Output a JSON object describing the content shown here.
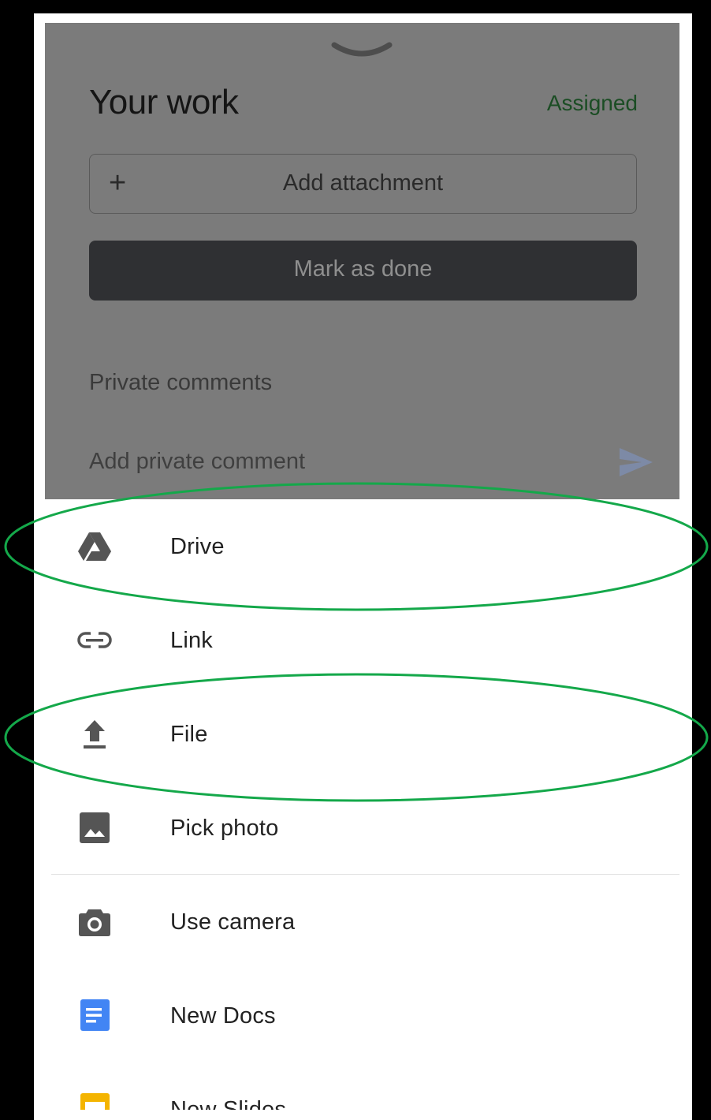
{
  "card": {
    "title": "Your work",
    "status": "Assigned",
    "add_attachment_label": "Add attachment",
    "add_icon_glyph": "+",
    "mark_done_label": "Mark as done",
    "private_comments_heading": "Private comments",
    "comment_placeholder": "Add private comment"
  },
  "sheet": {
    "items": [
      {
        "label": "Drive",
        "icon": "drive-icon"
      },
      {
        "label": "Link",
        "icon": "link-icon"
      },
      {
        "label": "File",
        "icon": "upload-icon"
      },
      {
        "label": "Pick photo",
        "icon": "image-icon"
      },
      {
        "label": "Use camera",
        "icon": "camera-icon"
      },
      {
        "label": "New Docs",
        "icon": "docs-icon"
      },
      {
        "label": "New Slides",
        "icon": "slides-icon"
      }
    ]
  },
  "colors": {
    "status_green": "#1b4d24",
    "annotation_green": "#14a84a",
    "docs_blue": "#4285f4",
    "slides_yellow": "#f4b400"
  }
}
